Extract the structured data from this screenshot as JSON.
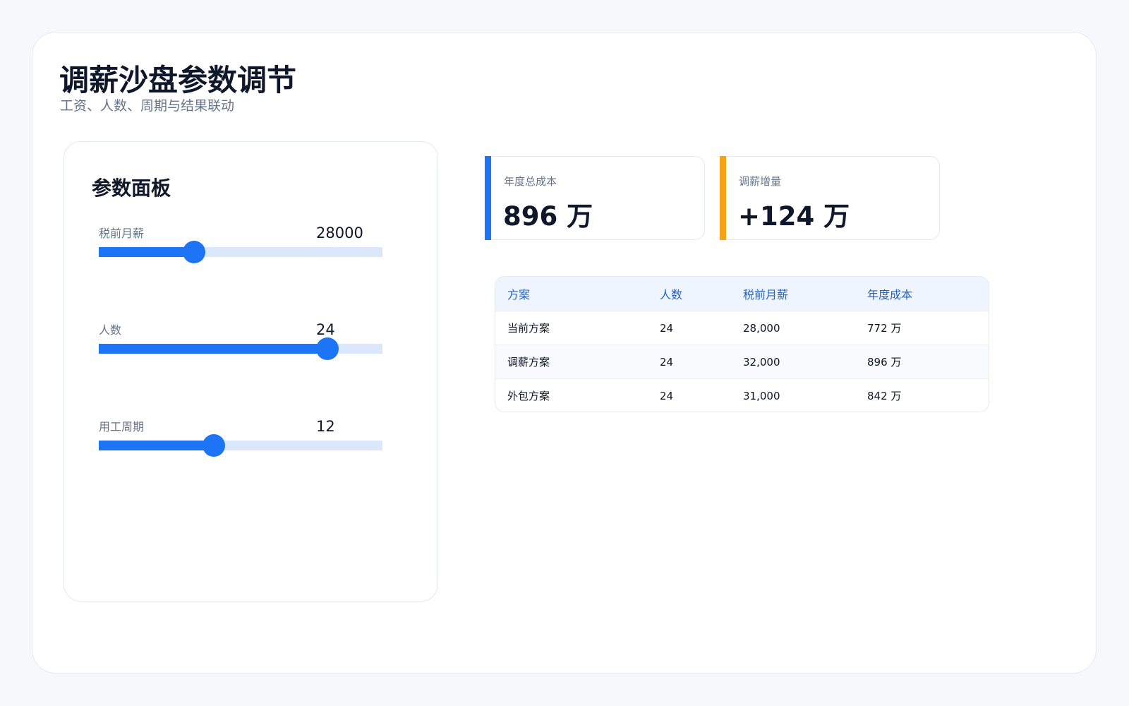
{
  "header": {
    "title": "调薪沙盘参数调节",
    "subtitle": "工资、人数、周期与结果联动"
  },
  "panel": {
    "title": "参数面板",
    "sliders": [
      {
        "label": "税前月薪",
        "value": "28000",
        "fill_percent": 33.5
      },
      {
        "label": "人数",
        "value": "24",
        "fill_percent": 80.5
      },
      {
        "label": "用工周期",
        "value": "12",
        "fill_percent": 40.5
      }
    ]
  },
  "kpis": [
    {
      "label": "年度总成本",
      "value": "896 万",
      "accent": "#1d74f5"
    },
    {
      "label": "调薪增量",
      "value": "+124 万",
      "accent": "#f5a316"
    }
  ],
  "table": {
    "columns": [
      "方案",
      "人数",
      "税前月薪",
      "年度成本"
    ],
    "rows": [
      [
        "当前方案",
        "24",
        "28,000",
        "772 万"
      ],
      [
        "调薪方案",
        "24",
        "32,000",
        "896 万"
      ],
      [
        "外包方案",
        "24",
        "31,000",
        "842 万"
      ]
    ]
  },
  "colors": {
    "primary": "#1d74f5",
    "accent_orange": "#f5a316",
    "track": "#dbe8fc"
  }
}
